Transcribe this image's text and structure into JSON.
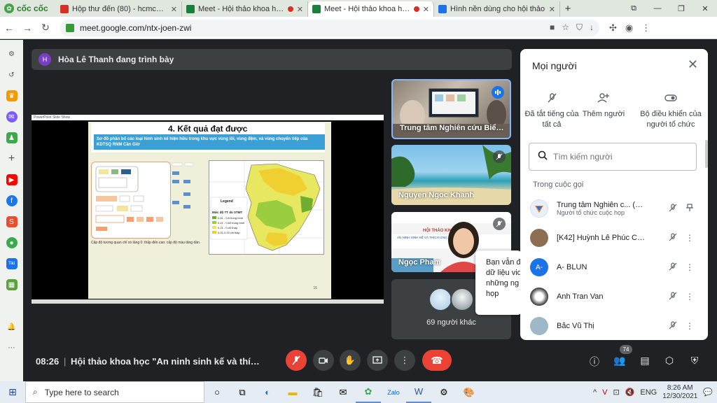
{
  "browser": {
    "brand": "cốc cốc",
    "tabs": [
      {
        "label": "Hộp thư đến (80) - hcmcois@",
        "color": "#d93025",
        "recording": false,
        "active": false
      },
      {
        "label": "Meet - Hội thảo khoa học",
        "color": "#188038",
        "recording": true,
        "active": false
      },
      {
        "label": "Meet - Hội thảo khoa học",
        "color": "#188038",
        "recording": true,
        "active": true
      },
      {
        "label": "Hình nền dùng cho hội thảo",
        "color": "#1a73e8",
        "recording": false,
        "active": false
      }
    ],
    "url": "meet.google.com/ntx-joen-zwi"
  },
  "meeting": {
    "presenter_initial": "H",
    "presenter_banner": "Hòa Lê Thanh đang trình bày",
    "time": "08:26",
    "title": "Hội thảo khoa học \"An ninh sinh kế và thích ...",
    "others_count": "69 người khác",
    "participants_badge": "74"
  },
  "slide": {
    "heading": "4. Kết quả đạt được",
    "banner": "Sơ đồ phân bố các loại hình sinh kế hiện hữu trong khu vực vùng lõi, vùng đệm, và vùng chuyển tiếp của KDTSQ RNM Cần Giờ",
    "caption": "Cấp độ tương quan chỉ có tầng 0: thấp đến cao: cấp độ màu tăng dần.",
    "page": "15",
    "legend_title": "Legend",
    "legend_levels_title": "Mức độ TT do STMT",
    "legend_levels": [
      "0.61 - 0.8 trung bình",
      "0.41 - 0.60 trung bình",
      "0.21 - 0.40 thấp",
      "0.01-0.20 rất thấp"
    ]
  },
  "tiles": [
    {
      "name": "Trung tâm Nghiên cứu Biển...",
      "speaking": true
    },
    {
      "name": "Nguyen Ngoc Khanh",
      "speaking": false
    },
    {
      "name": "Ngọc Pham",
      "speaking": false
    }
  ],
  "tooltip": {
    "lines": [
      "Bạn vẫn đ",
      "dữ liệu vid",
      "những ng",
      "họp"
    ]
  },
  "people_panel": {
    "title": "Mọi người",
    "actions": [
      {
        "label": "Đã tắt tiếng của tất cả",
        "icon": "mic-off-icon"
      },
      {
        "label": "Thêm người",
        "icon": "add-person-icon"
      },
      {
        "label": "Bộ điều khiển của người tổ chức",
        "icon": "toggle-icon"
      }
    ],
    "search_placeholder": "Tìm kiếm người",
    "section_label": "Trong cuộc gọi",
    "participants": [
      {
        "name": "Trung tâm Nghiên c... (Bạn)",
        "subtitle": "Người tổ chức cuộc họp",
        "avatar_color": "#e8f0fe",
        "initial": ""
      },
      {
        "name": "[K42] Huỳnh Lê Phúc Chá...",
        "subtitle": "",
        "avatar_color": "#8d6e53",
        "initial": ""
      },
      {
        "name": "A- BLUN",
        "subtitle": "",
        "avatar_color": "#1a73e8",
        "initial": "A-"
      },
      {
        "name": "Anh Tran Van",
        "subtitle": "",
        "avatar_color": "#d9d9d9",
        "initial": ""
      },
      {
        "name": "Bắc Vũ Thị",
        "subtitle": "",
        "avatar_color": "#9fb8c8",
        "initial": ""
      }
    ]
  },
  "taskbar": {
    "search_placeholder": "Type here to search",
    "time": "8:26 AM",
    "date": "12/30/2021",
    "language": "ENG"
  }
}
